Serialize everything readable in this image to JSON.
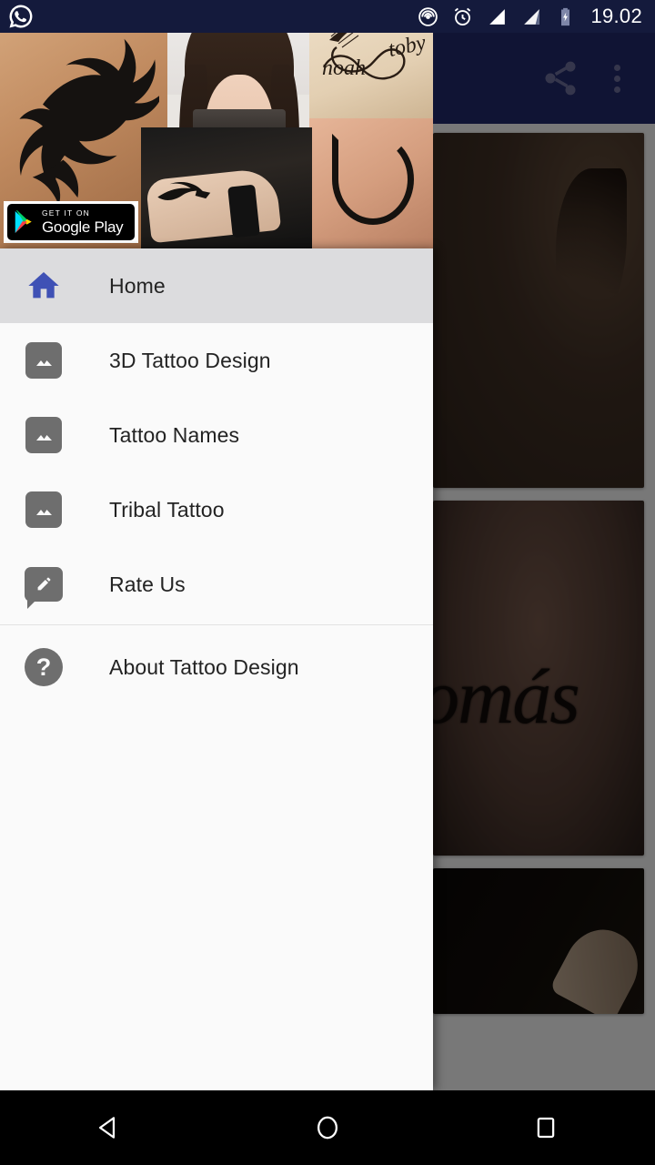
{
  "status_bar": {
    "time": "19.02",
    "icons": [
      "whatsapp-icon",
      "cast-icon",
      "alarm-icon",
      "signal-icon-1",
      "signal-icon-2",
      "battery-charging-icon"
    ],
    "background_color": "#141a3c"
  },
  "app_bar": {
    "background_color": "#1f2560",
    "actions": [
      {
        "name": "share-button",
        "icon": "share-icon"
      },
      {
        "name": "overflow-button",
        "icon": "more-vert-icon"
      }
    ]
  },
  "promo_ad": {
    "name": "house-ad-banner",
    "store_badge": {
      "small_label": "GET IT ON",
      "big_label": "Google Play",
      "icon": "google-play-icon"
    },
    "images": [
      {
        "name": "tribal-dragon-tattoo",
        "alt": "tribal dragon tattoo on shoulder"
      },
      {
        "name": "camera-hands-tattoo",
        "alt": "woman holding camera-tattooed hands over eyes"
      },
      {
        "name": "infinity-names-tattoo",
        "alt": "infinity feather tattoo",
        "text_left": "noah",
        "text_right": "toby"
      },
      {
        "name": "hook-hand-tattoo",
        "alt": "fish hook tattoo on hand"
      },
      {
        "name": "tribal-forearm-tattoo",
        "alt": "tribal forearm tattoo with wristband"
      }
    ]
  },
  "drawer": {
    "background_color": "#fafafa",
    "selected_color": "#dcdcde",
    "accent_color": "#3f51b5",
    "items": [
      {
        "label": "Home",
        "icon": "home-icon",
        "selected": true
      },
      {
        "label": "3D Tattoo Design",
        "icon": "image-icon",
        "selected": false
      },
      {
        "label": "Tattoo Names",
        "icon": "image-icon",
        "selected": false
      },
      {
        "label": "Tribal Tattoo",
        "icon": "image-icon",
        "selected": false
      },
      {
        "label": "Rate Us",
        "icon": "rate-review-icon",
        "selected": false
      }
    ],
    "footer_items": [
      {
        "label": "About Tattoo Design",
        "icon": "help-circle-icon",
        "selected": false
      }
    ]
  },
  "content": {
    "cards": [
      {
        "name": "tattoo-photo-card-1",
        "alt": "dark skin tattoo photo"
      },
      {
        "name": "tattoo-photo-card-2",
        "alt": "script tattoo photo",
        "script_text": "omás"
      },
      {
        "name": "tattoo-photo-card-3",
        "alt": "dark arm tattoo photo"
      }
    ]
  },
  "system_nav": {
    "buttons": [
      {
        "name": "back-button",
        "icon": "back-triangle-icon"
      },
      {
        "name": "home-button",
        "icon": "home-circle-icon"
      },
      {
        "name": "recents-button",
        "icon": "recents-square-icon"
      }
    ]
  }
}
